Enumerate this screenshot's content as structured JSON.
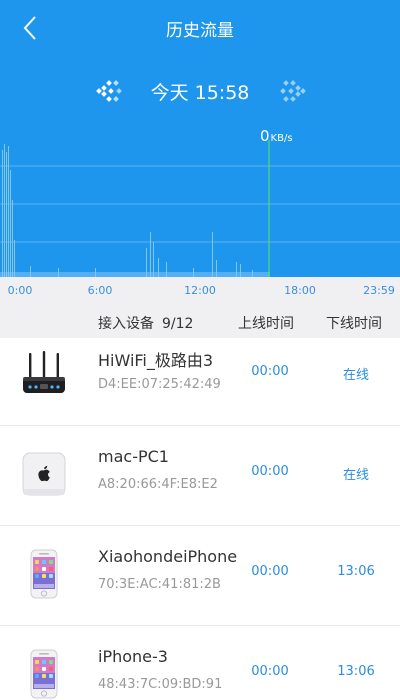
{
  "header": {
    "title": "历史流量",
    "back_icon": "chevron-left-icon"
  },
  "date_nav": {
    "label": "今天 15:58",
    "prev_icon": "double-chevron-left-icon",
    "next_icon": "double-chevron-right-icon"
  },
  "speed": {
    "value": "0",
    "unit": "KB/s"
  },
  "colors": {
    "accent": "#1e96ee",
    "link": "#2a8ee0",
    "cursor_line": "#4fd97a"
  },
  "chart_data": {
    "type": "area",
    "x_ticks": [
      "0:00",
      "6:00",
      "12:00",
      "18:00",
      "23:59"
    ],
    "cursor_time": "15:58",
    "current_value": 0,
    "unit": "KB/s"
  },
  "list_header": {
    "devices_label": "接入设备",
    "count": "9/12",
    "online_label": "上线时间",
    "offline_label": "下线时间"
  },
  "devices": [
    {
      "name": "HiWiFi_极路由3",
      "mac": "D4:EE:07:25:42:49",
      "online": "00:00",
      "offline": "在线",
      "icon": "router-icon"
    },
    {
      "name": "mac-PC1",
      "mac": "A8:20:66:4F:E8:E2",
      "online": "00:00",
      "offline": "在线",
      "icon": "apple-icon"
    },
    {
      "name": "XiaohondeiPhone",
      "mac": "70:3E:AC:41:81:2B",
      "online": "00:00",
      "offline": "13:06",
      "icon": "iphone-icon"
    },
    {
      "name": "iPhone-3",
      "mac": "48:43:7C:09:BD:91",
      "online": "00:00",
      "offline": "13:06",
      "icon": "iphone-icon"
    }
  ]
}
